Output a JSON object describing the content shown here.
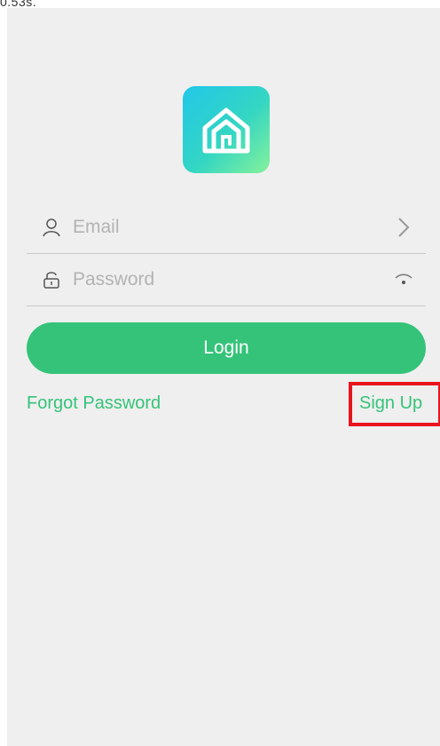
{
  "header": {
    "caption": "0.53s."
  },
  "logo": {
    "brand_color_start": "#22c7e8",
    "brand_color_end": "#86f29a",
    "icon": "home-icon"
  },
  "login_form": {
    "email": {
      "placeholder": "Email",
      "value": "",
      "lead_icon": "user-icon",
      "trail_icon": "chevron-right-icon"
    },
    "password": {
      "placeholder": "Password",
      "value": "",
      "lead_icon": "lock-icon",
      "trail_icon": "eye-closed-icon"
    },
    "login_label": "Login",
    "forgot_password_label": "Forgot Password",
    "sign_up_label": "Sign Up"
  },
  "colors": {
    "accent": "#35c379",
    "background": "#efefef",
    "highlight": "#e8141d"
  }
}
